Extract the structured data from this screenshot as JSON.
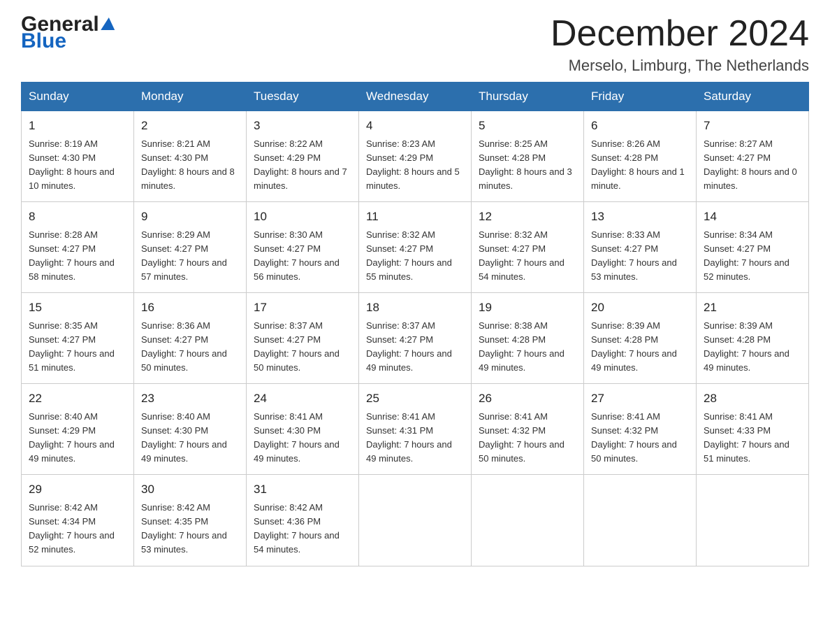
{
  "header": {
    "logo_general": "General",
    "logo_blue": "Blue",
    "month_title": "December 2024",
    "location": "Merselo, Limburg, The Netherlands"
  },
  "weekdays": [
    "Sunday",
    "Monday",
    "Tuesday",
    "Wednesday",
    "Thursday",
    "Friday",
    "Saturday"
  ],
  "weeks": [
    [
      {
        "day": "1",
        "sunrise": "8:19 AM",
        "sunset": "4:30 PM",
        "daylight": "8 hours and 10 minutes."
      },
      {
        "day": "2",
        "sunrise": "8:21 AM",
        "sunset": "4:30 PM",
        "daylight": "8 hours and 8 minutes."
      },
      {
        "day": "3",
        "sunrise": "8:22 AM",
        "sunset": "4:29 PM",
        "daylight": "8 hours and 7 minutes."
      },
      {
        "day": "4",
        "sunrise": "8:23 AM",
        "sunset": "4:29 PM",
        "daylight": "8 hours and 5 minutes."
      },
      {
        "day": "5",
        "sunrise": "8:25 AM",
        "sunset": "4:28 PM",
        "daylight": "8 hours and 3 minutes."
      },
      {
        "day": "6",
        "sunrise": "8:26 AM",
        "sunset": "4:28 PM",
        "daylight": "8 hours and 1 minute."
      },
      {
        "day": "7",
        "sunrise": "8:27 AM",
        "sunset": "4:27 PM",
        "daylight": "8 hours and 0 minutes."
      }
    ],
    [
      {
        "day": "8",
        "sunrise": "8:28 AM",
        "sunset": "4:27 PM",
        "daylight": "7 hours and 58 minutes."
      },
      {
        "day": "9",
        "sunrise": "8:29 AM",
        "sunset": "4:27 PM",
        "daylight": "7 hours and 57 minutes."
      },
      {
        "day": "10",
        "sunrise": "8:30 AM",
        "sunset": "4:27 PM",
        "daylight": "7 hours and 56 minutes."
      },
      {
        "day": "11",
        "sunrise": "8:32 AM",
        "sunset": "4:27 PM",
        "daylight": "7 hours and 55 minutes."
      },
      {
        "day": "12",
        "sunrise": "8:32 AM",
        "sunset": "4:27 PM",
        "daylight": "7 hours and 54 minutes."
      },
      {
        "day": "13",
        "sunrise": "8:33 AM",
        "sunset": "4:27 PM",
        "daylight": "7 hours and 53 minutes."
      },
      {
        "day": "14",
        "sunrise": "8:34 AM",
        "sunset": "4:27 PM",
        "daylight": "7 hours and 52 minutes."
      }
    ],
    [
      {
        "day": "15",
        "sunrise": "8:35 AM",
        "sunset": "4:27 PM",
        "daylight": "7 hours and 51 minutes."
      },
      {
        "day": "16",
        "sunrise": "8:36 AM",
        "sunset": "4:27 PM",
        "daylight": "7 hours and 50 minutes."
      },
      {
        "day": "17",
        "sunrise": "8:37 AM",
        "sunset": "4:27 PM",
        "daylight": "7 hours and 50 minutes."
      },
      {
        "day": "18",
        "sunrise": "8:37 AM",
        "sunset": "4:27 PM",
        "daylight": "7 hours and 49 minutes."
      },
      {
        "day": "19",
        "sunrise": "8:38 AM",
        "sunset": "4:28 PM",
        "daylight": "7 hours and 49 minutes."
      },
      {
        "day": "20",
        "sunrise": "8:39 AM",
        "sunset": "4:28 PM",
        "daylight": "7 hours and 49 minutes."
      },
      {
        "day": "21",
        "sunrise": "8:39 AM",
        "sunset": "4:28 PM",
        "daylight": "7 hours and 49 minutes."
      }
    ],
    [
      {
        "day": "22",
        "sunrise": "8:40 AM",
        "sunset": "4:29 PM",
        "daylight": "7 hours and 49 minutes."
      },
      {
        "day": "23",
        "sunrise": "8:40 AM",
        "sunset": "4:30 PM",
        "daylight": "7 hours and 49 minutes."
      },
      {
        "day": "24",
        "sunrise": "8:41 AM",
        "sunset": "4:30 PM",
        "daylight": "7 hours and 49 minutes."
      },
      {
        "day": "25",
        "sunrise": "8:41 AM",
        "sunset": "4:31 PM",
        "daylight": "7 hours and 49 minutes."
      },
      {
        "day": "26",
        "sunrise": "8:41 AM",
        "sunset": "4:32 PM",
        "daylight": "7 hours and 50 minutes."
      },
      {
        "day": "27",
        "sunrise": "8:41 AM",
        "sunset": "4:32 PM",
        "daylight": "7 hours and 50 minutes."
      },
      {
        "day": "28",
        "sunrise": "8:41 AM",
        "sunset": "4:33 PM",
        "daylight": "7 hours and 51 minutes."
      }
    ],
    [
      {
        "day": "29",
        "sunrise": "8:42 AM",
        "sunset": "4:34 PM",
        "daylight": "7 hours and 52 minutes."
      },
      {
        "day": "30",
        "sunrise": "8:42 AM",
        "sunset": "4:35 PM",
        "daylight": "7 hours and 53 minutes."
      },
      {
        "day": "31",
        "sunrise": "8:42 AM",
        "sunset": "4:36 PM",
        "daylight": "7 hours and 54 minutes."
      },
      null,
      null,
      null,
      null
    ]
  ],
  "labels": {
    "sunrise": "Sunrise:",
    "sunset": "Sunset:",
    "daylight": "Daylight:"
  }
}
